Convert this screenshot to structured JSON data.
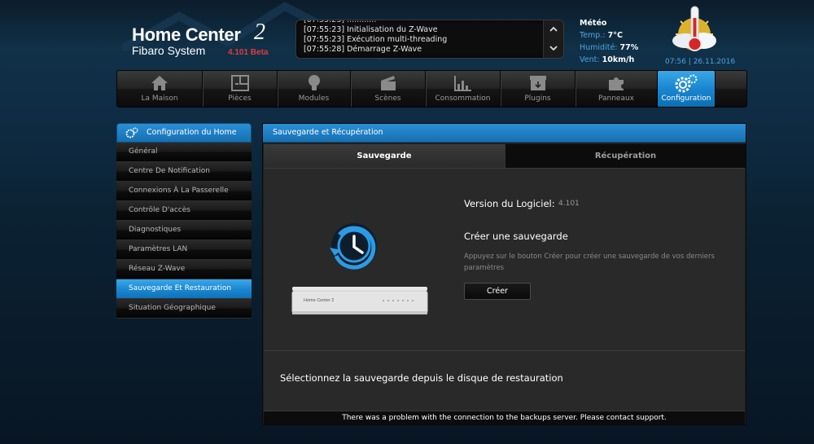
{
  "header": {
    "logo_title": "Home Center",
    "logo_number": "2",
    "logo_subtitle": "Fibaro System",
    "version": "4.101 Beta"
  },
  "event_log": {
    "lines": [
      "[07:55:23] Initialisation du Z-Wave",
      "[07:55:23] Exécution multi-threading",
      "[07:55:28] Démarrage Z-Wave"
    ],
    "scroll_up": "︿",
    "scroll_down": "﹀"
  },
  "weather": {
    "title": "Météo",
    "temp_label": "Temp.:",
    "temp_value": "7°C",
    "humidity_label": "Humidité:",
    "humidity_value": "77%",
    "wind_label": "Vent:",
    "wind_value": "10km/h",
    "datetime": "07:56 | 26.11.2016"
  },
  "nav": {
    "items": [
      {
        "label": "La Maison",
        "icon": "house-icon"
      },
      {
        "label": "Pièces",
        "icon": "rooms-icon"
      },
      {
        "label": "Modules",
        "icon": "bulb-icon"
      },
      {
        "label": "Scènes",
        "icon": "clapper-icon"
      },
      {
        "label": "Consommation",
        "icon": "chart-icon"
      },
      {
        "label": "Plugins",
        "icon": "box-icon"
      },
      {
        "label": "Panneaux",
        "icon": "puzzle-icon"
      },
      {
        "label": "Configuration",
        "icon": "gears-icon"
      }
    ],
    "active": "Configuration"
  },
  "sidebar": {
    "title": "Configuration du Home",
    "items": [
      "Général",
      "Centre De Notification",
      "Connexions À La Passerelle",
      "Contrôle D'accès",
      "Diagnostiques",
      "Paramètres LAN",
      "Réseau Z-Wave",
      "Sauvegarde Et Restauration",
      "Situation Géographique"
    ],
    "active": "Sauvegarde Et Restauration"
  },
  "main": {
    "title": "Sauvegarde et Récupération",
    "tabs": [
      "Sauvegarde",
      "Récupération"
    ],
    "active_tab": "Sauvegarde",
    "version_label": "Version du Logiciel:",
    "version_value": "4.101",
    "create_title": "Créer une sauvegarde",
    "create_desc": "Appuyez sur le bouton Créer pour créer une sauvegarde de vos derniers paramètres",
    "create_button": "Créer",
    "restore_text": "Sélectionnez la sauvegarde depuis le disque de restauration",
    "device_label": "Home Center 2",
    "footer_message": "There was a problem with the connection to the backups server. Please contact support."
  },
  "colors": {
    "accent": "#1a86cf",
    "version_red": "#e23b3b",
    "weather_label": "#4aa6e0"
  }
}
